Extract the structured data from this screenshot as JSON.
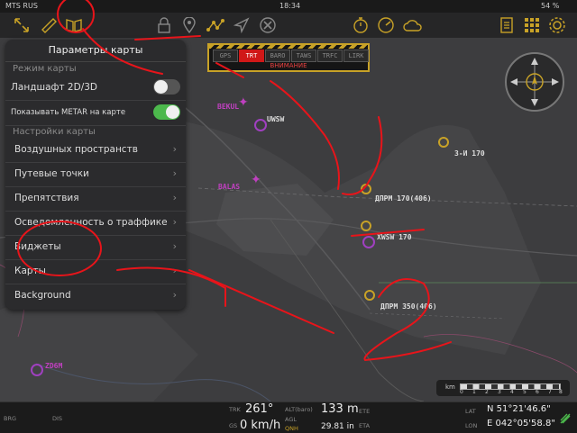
{
  "status": {
    "carrier": "MTS RUS",
    "time": "18:34",
    "battery": "54 %"
  },
  "toolbar": {
    "icons": [
      "expand-arrows-icon",
      "ruler-icon",
      "map-book-icon",
      "lock-icon",
      "location-pin-icon",
      "route-icon",
      "navigate-arrow-icon",
      "close-circle-icon",
      "stopwatch-icon",
      "gauge-icon",
      "weather-cloud-icon",
      "document-icon",
      "grid-menu-icon",
      "settings-gear-icon"
    ]
  },
  "alerts": {
    "buttons": [
      "GPS",
      "TRT",
      "BARO",
      "TAWS",
      "TRFC",
      "LIRK"
    ],
    "warning": "ВНИМАНИЕ"
  },
  "panel": {
    "title": "Параметры карты",
    "section_mode": "Режим карты",
    "landscape_label": "Ландшафт 2D/3D",
    "metar_label": "Показывать METAR на карте",
    "section_settings": "Настройки карты",
    "items": [
      {
        "label": "Воздушных пространств"
      },
      {
        "label": "Путевые точки"
      },
      {
        "label": "Препятствия"
      },
      {
        "label": "Осведомленность о траффике"
      },
      {
        "label": "Виджеты"
      },
      {
        "label": "Карты"
      },
      {
        "label": "Background"
      }
    ]
  },
  "map_labels": {
    "bekul": "BEKUL",
    "uwsw": "UWSW",
    "balas": "BALAS",
    "ndb1": "З-И 170",
    "ndb2": "ДПРМ 170(406)",
    "xwsw": "XWSW 170",
    "ndb3": "ДПРМ 350(406)",
    "zd6m": "ZD6M"
  },
  "scale": {
    "unit": "km",
    "ticks": [
      "0",
      "1",
      "2",
      "3",
      "4",
      "5",
      "6",
      "7",
      "8"
    ]
  },
  "bottom": {
    "brg_label": "BRG",
    "dis_label": "DIS",
    "trk_label": "TRK",
    "trk_value": "261°",
    "gs_label": "GS",
    "gs_value": "0 km/h",
    "alt_label": "ALT(baro)",
    "alt_value": "133 m",
    "agl_label": "AGL",
    "qnh_label": "QNH",
    "qnh_value": "29.81 in",
    "ete_label": "ETE",
    "eta_label": "ETA",
    "lat_label": "LAT",
    "lat_value": "N 51°21'46.6\"",
    "lon_label": "LON",
    "lon_value": "E 042°05'58.8\""
  },
  "colors": {
    "accent": "#c8a227",
    "annotation": "#e8141a",
    "toggle_on": "#4cb84c",
    "waypoint": "#a020a0"
  }
}
